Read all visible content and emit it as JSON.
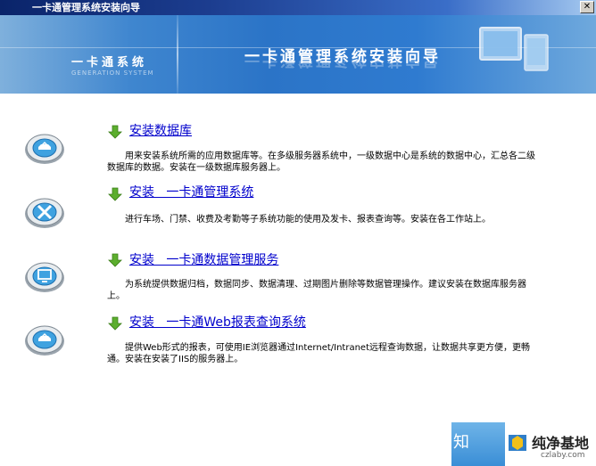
{
  "window": {
    "title": "一卡通管理系统安装向导",
    "close_label": "✕"
  },
  "banner": {
    "left_title": "一卡通系统",
    "left_subtitle": "GENERATION SYSTEM",
    "main_title": "一卡通管理系统安装向导"
  },
  "items": [
    {
      "label": "安装数据库",
      "description": "用来安装系统所需的应用数据库等。在多级服务器系统中，一级数据中心是系统的数据中心，汇总各二级数据库的数据。安装在一级数据库服务器上。",
      "icon": "database-disc-icon"
    },
    {
      "label": "安装   一卡通管理系统",
      "description": "进行车场、门禁、收费及考勤等子系统功能的使用及发卡、报表查询等。安装在各工作站上。",
      "icon": "tools-disc-icon"
    },
    {
      "label": "安装   一卡通数据管理服务",
      "description": "为系统提供数据归档，数据同步、数据清理、过期图片删除等数据管理操作。建议安装在数据库服务器上。",
      "icon": "server-disc-icon"
    },
    {
      "label": "安装   一卡通Web报表查询系统",
      "description": "提供Web形式的报表，可使用IE浏览器通过Internet/Intranet远程查询数据，让数据共享更方便，更畅通。安装在安装了IIS的服务器上。",
      "icon": "web-disc-icon"
    }
  ],
  "watermark": {
    "prefix": "知",
    "brand": "纯净基地",
    "url": "czlaby.com"
  },
  "colors": {
    "title_bar": "#0a246a",
    "banner": "#2b74c7",
    "link": "#0000cc",
    "arrow": "#5cae2e"
  }
}
